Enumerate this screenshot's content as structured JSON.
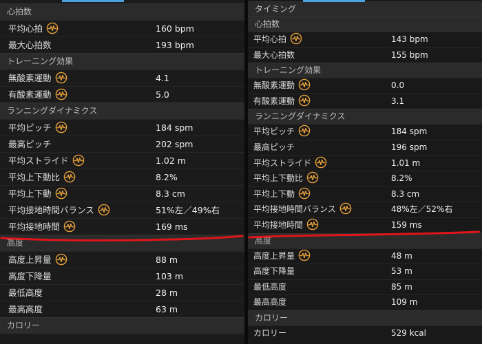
{
  "left": {
    "sections": [
      {
        "header": "心拍数",
        "rows": [
          {
            "label": "平均心拍",
            "icon": true,
            "value": "160 bpm"
          },
          {
            "label": "最大心拍数",
            "icon": false,
            "value": "193 bpm"
          }
        ]
      },
      {
        "header": "トレーニング効果",
        "rows": [
          {
            "label": "無酸素運動",
            "icon": true,
            "value": "4.1"
          },
          {
            "label": "有酸素運動",
            "icon": true,
            "value": "5.0"
          }
        ]
      },
      {
        "header": "ランニングダイナミクス",
        "rows": [
          {
            "label": "平均ピッチ",
            "icon": true,
            "value": "184 spm"
          },
          {
            "label": "最高ピッチ",
            "icon": false,
            "value": "202 spm"
          },
          {
            "label": "平均ストライド",
            "icon": true,
            "value": "1.02 m"
          },
          {
            "label": "平均上下動比",
            "icon": true,
            "value": "8.2%"
          },
          {
            "label": "平均上下動",
            "icon": true,
            "value": "8.3 cm"
          },
          {
            "label": "平均接地時間バランス",
            "icon": true,
            "value": "51%左／49%右"
          },
          {
            "label": "平均接地時間",
            "icon": true,
            "value": "169 ms"
          }
        ]
      },
      {
        "header": "高度",
        "rows": [
          {
            "label": "高度上昇量",
            "icon": true,
            "value": "88 m"
          },
          {
            "label": "高度下降量",
            "icon": false,
            "value": "103 m"
          },
          {
            "label": "最低高度",
            "icon": false,
            "value": "28 m"
          },
          {
            "label": "最高高度",
            "icon": false,
            "value": "63 m"
          }
        ]
      },
      {
        "header": "カロリー",
        "rows": []
      }
    ]
  },
  "right": {
    "sections": [
      {
        "header": "タイミング",
        "rows": []
      },
      {
        "header": "心拍数",
        "rows": [
          {
            "label": "平均心拍",
            "icon": true,
            "value": "143 bpm"
          },
          {
            "label": "最大心拍数",
            "icon": false,
            "value": "155 bpm"
          }
        ]
      },
      {
        "header": "トレーニング効果",
        "rows": [
          {
            "label": "無酸素運動",
            "icon": true,
            "value": "0.0"
          },
          {
            "label": "有酸素運動",
            "icon": true,
            "value": "3.1"
          }
        ]
      },
      {
        "header": "ランニングダイナミクス",
        "rows": [
          {
            "label": "平均ピッチ",
            "icon": true,
            "value": "184 spm"
          },
          {
            "label": "最高ピッチ",
            "icon": false,
            "value": "196 spm"
          },
          {
            "label": "平均ストライド",
            "icon": true,
            "value": "1.01 m"
          },
          {
            "label": "平均上下動比",
            "icon": true,
            "value": "8.2%"
          },
          {
            "label": "平均上下動",
            "icon": true,
            "value": "8.3 cm"
          },
          {
            "label": "平均接地時間バランス",
            "icon": true,
            "value": "48%左／52%右"
          },
          {
            "label": "平均接地時間",
            "icon": true,
            "value": "159 ms"
          }
        ]
      },
      {
        "header": "高度",
        "rows": [
          {
            "label": "高度上昇量",
            "icon": true,
            "value": "48 m"
          },
          {
            "label": "高度下降量",
            "icon": false,
            "value": "53 m"
          },
          {
            "label": "最低高度",
            "icon": false,
            "value": "85 m"
          },
          {
            "label": "最高高度",
            "icon": false,
            "value": "109 m"
          }
        ]
      },
      {
        "header": "カロリー",
        "rows": [
          {
            "label": "カロリー",
            "icon": false,
            "value": "529 kcal"
          }
        ]
      }
    ]
  },
  "colors": {
    "icon": "#e8a13a",
    "annotation": "#e0151b",
    "tab_indicator": "#4aa3e0"
  }
}
